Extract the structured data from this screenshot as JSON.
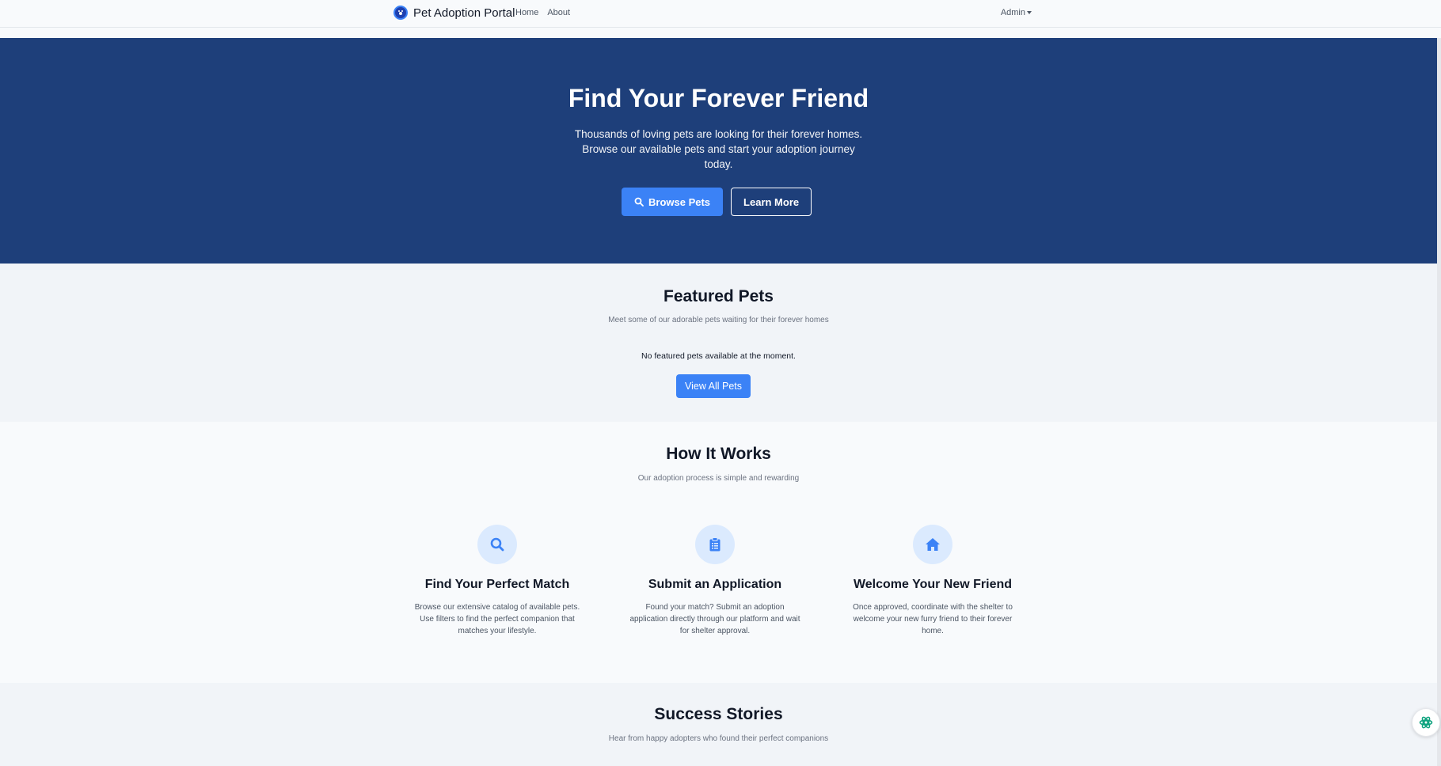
{
  "navbar": {
    "brand": "Pet Adoption Portal",
    "links": [
      "Home",
      "About"
    ],
    "user_menu": "Admin"
  },
  "hero": {
    "title": "Find Your Forever Friend",
    "subtitle": "Thousands of loving pets are looking for their forever homes. Browse our available pets and start your adoption journey today.",
    "primary_button": "Browse Pets",
    "secondary_button": "Learn More"
  },
  "featured": {
    "title": "Featured Pets",
    "subtitle": "Meet some of our adorable pets waiting for their forever homes",
    "empty_message": "No featured pets available at the moment.",
    "button": "View All Pets"
  },
  "how_it_works": {
    "title": "How It Works",
    "subtitle": "Our adoption process is simple and rewarding",
    "steps": [
      {
        "icon": "search-icon",
        "title": "Find Your Perfect Match",
        "description": "Browse our extensive catalog of available pets. Use filters to find the perfect companion that matches your lifestyle."
      },
      {
        "icon": "clipboard-icon",
        "title": "Submit an Application",
        "description": "Found your match? Submit an adoption application directly through our platform and wait for shelter approval."
      },
      {
        "icon": "home-icon",
        "title": "Welcome Your New Friend",
        "description": "Once approved, coordinate with the shelter to welcome your new furry friend to their forever home."
      }
    ]
  },
  "success": {
    "title": "Success Stories",
    "subtitle": "Hear from happy adopters who found their perfect companions"
  },
  "colors": {
    "hero_bg": "#1e3f7a",
    "accent": "#3b82f6",
    "icon_bg": "#dbeafe"
  }
}
